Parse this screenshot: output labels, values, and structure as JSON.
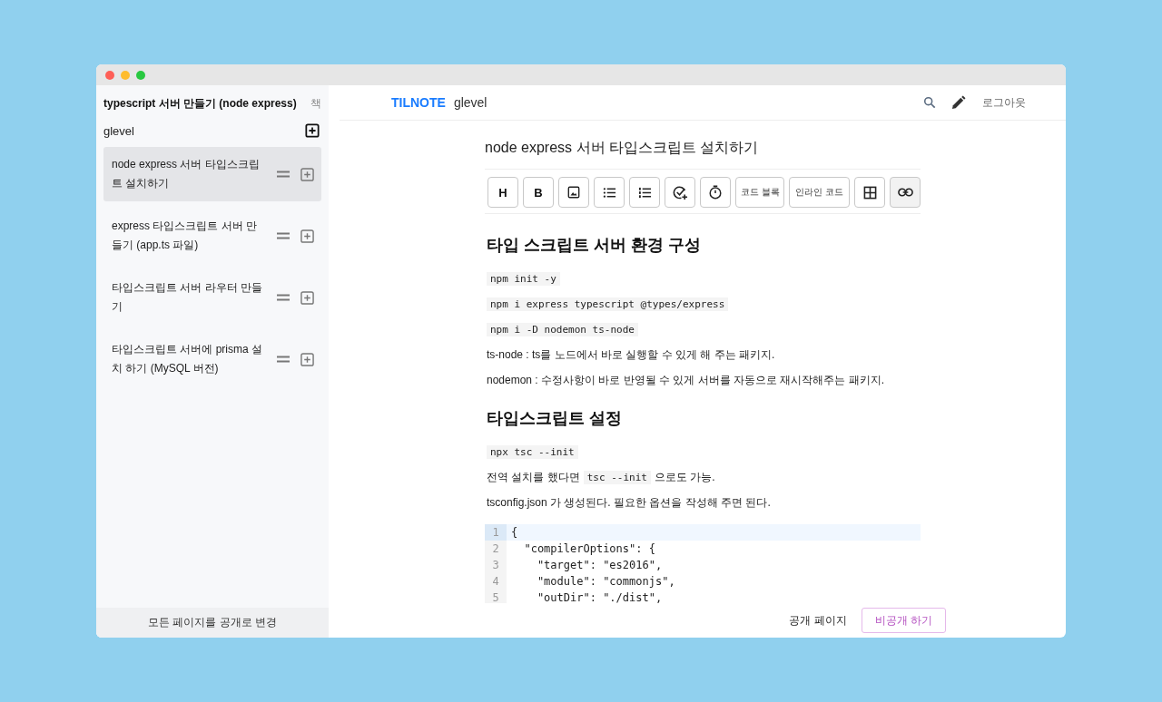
{
  "book_title": "typescript 서버 만들기 (node express)",
  "book_tab": "책",
  "author": "glevel",
  "pages": [
    {
      "title": "node express 서버 타입스크립트 설치하기",
      "selected": true
    },
    {
      "title": "express 타입스크립트 서버 만들기 (app.ts 파일)",
      "selected": false
    },
    {
      "title": "타입스크립트 서버 라우터 만들기",
      "selected": false
    },
    {
      "title": "타입스크립트 서버에 prisma 설치 하기 (MySQL 버전)",
      "selected": false
    }
  ],
  "sidebar_footer": "모든 페이지를 공개로 변경",
  "header": {
    "logo": "TILNOTE",
    "user": "glevel",
    "logout": "로그아웃"
  },
  "page_title": "node express 서버 타입스크립트 설치하기",
  "toolbar_labels": [
    "H",
    "B",
    "코드 블록",
    "인라인 코드"
  ],
  "blocks": [
    {
      "kind": "heading",
      "text": "타입 스크립트 서버 환경 구성"
    },
    {
      "kind": "code",
      "text": "npm init -y"
    },
    {
      "kind": "code",
      "text": "npm i express typescript @types/express"
    },
    {
      "kind": "code",
      "text": "npm i -D nodemon ts-node"
    },
    {
      "kind": "text",
      "text": "ts-node : ts를 노드에서 바로 실행할 수 있게 해 주는 패키지."
    },
    {
      "kind": "text",
      "text": "nodemon : 수정사항이 바로 반영될 수 있게 서버를 자동으로 재시작해주는 패키지."
    },
    {
      "kind": "heading",
      "text": "타입스크립트 설정"
    },
    {
      "kind": "code",
      "text": "npx tsc --init"
    },
    {
      "kind": "mixed",
      "parts": [
        {
          "kind": "text",
          "text": "전역 설치를 했다면"
        },
        {
          "kind": "code",
          "text": "tsc --init"
        },
        {
          "kind": "text",
          "text": "으로도 가능."
        }
      ]
    },
    {
      "kind": "text",
      "text": "tsconfig.json 가 생성된다. 필요한 옵션을 작성해 주면 된다."
    },
    {
      "kind": "codeblock",
      "lines": [
        {
          "number": "1",
          "text": "{",
          "selected": true
        },
        {
          "number": "2",
          "text": "  \"compilerOptions\": {",
          "selected": false
        },
        {
          "number": "3",
          "text": "    \"target\": \"es2016\",",
          "selected": false
        },
        {
          "number": "4",
          "text": "    \"module\": \"commonjs\",",
          "selected": false
        },
        {
          "number": "5",
          "text": "    \"outDir\": \"./dist\",",
          "selected": false
        }
      ]
    }
  ],
  "footer": {
    "status": "공개 페이지",
    "toggle": "비공개 하기"
  }
}
